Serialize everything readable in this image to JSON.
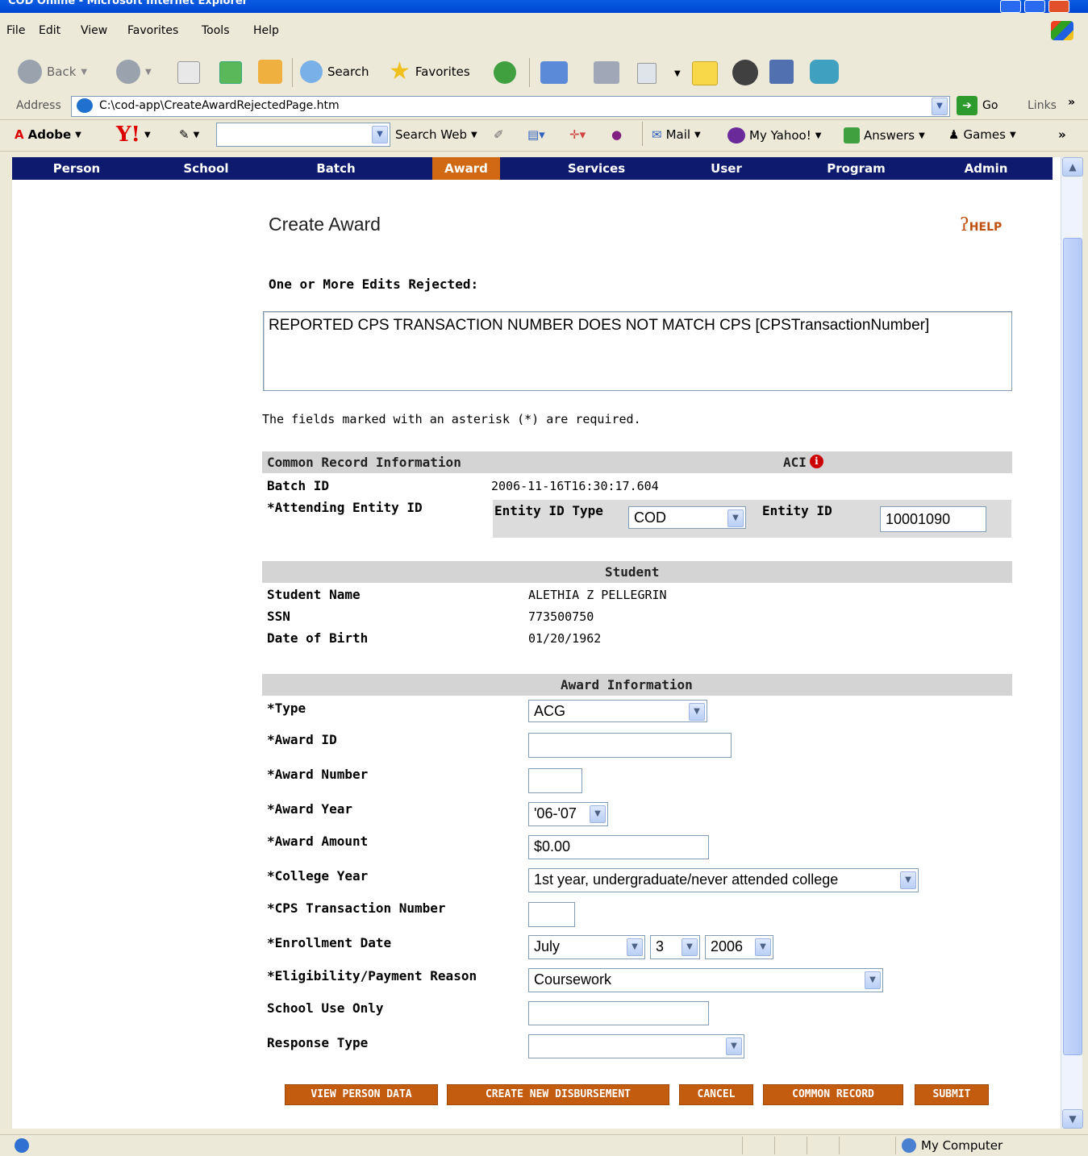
{
  "window": {
    "title": "COD Online - Microsoft Internet Explorer"
  },
  "menu": {
    "items": [
      "File",
      "Edit",
      "View",
      "Favorites",
      "Tools",
      "Help"
    ]
  },
  "toolbar": {
    "back": "Back",
    "search": "Search",
    "favorites": "Favorites"
  },
  "address": {
    "label": "Address",
    "url": "C:\\cod-app\\CreateAwardRejectedPage.htm",
    "go": "Go",
    "links": "Links"
  },
  "yahoo": {
    "adobe": "Adobe",
    "search_web": "Search Web",
    "mail": "Mail",
    "my_yahoo": "My Yahoo!",
    "answers": "Answers",
    "games": "Games"
  },
  "nav": {
    "items": [
      "Person",
      "School",
      "Batch",
      "Award",
      "Services",
      "User",
      "Program",
      "Admin"
    ],
    "active": "Award"
  },
  "page": {
    "title": "Create Award",
    "help": "HELP",
    "error_heading": "One or More Edits Rejected:",
    "error_message": "REPORTED CPS TRANSACTION NUMBER DOES NOT MATCH CPS [CPSTransactionNumber]",
    "required_note": "The fields marked with an asterisk (*) are required."
  },
  "common_record": {
    "section_title": "Common Record Information",
    "aci_label": "ACI",
    "batch_id_label": "Batch ID",
    "batch_id": "2006-11-16T16:30:17.604",
    "attending_entity_label": "*Attending Entity ID",
    "entity_id_type_label": "Entity ID Type",
    "entity_id_type": "COD",
    "entity_id_label": "Entity ID",
    "entity_id": "10001090"
  },
  "student": {
    "section_title": "Student",
    "name_label": "Student Name",
    "name": "ALETHIA Z PELLEGRIN",
    "ssn_label": "SSN",
    "ssn": "773500750",
    "dob_label": "Date of Birth",
    "dob": "01/20/1962"
  },
  "award": {
    "section_title": "Award Information",
    "type_label": "*Type",
    "type": "ACG",
    "award_id_label": "*Award ID",
    "award_id": "",
    "award_number_label": "*Award Number",
    "award_number": "",
    "award_year_label": "*Award Year",
    "award_year": "'06-'07",
    "award_amount_label": "*Award Amount",
    "award_amount": "$0.00",
    "college_year_label": "*College Year",
    "college_year": "1st year, undergraduate/never attended college",
    "cps_label": "*CPS Transaction Number",
    "cps": "",
    "enrollment_label": "*Enrollment Date",
    "enrollment_month": "July",
    "enrollment_day": "3",
    "enrollment_year": "2006",
    "eligibility_label": "*Eligibility/Payment Reason",
    "eligibility": "Coursework",
    "school_use_label": "School Use Only",
    "school_use": "",
    "response_type_label": "Response Type",
    "response_type": ""
  },
  "buttons": {
    "view_person": "VIEW PERSON DATA",
    "create_disbursement": "CREATE NEW DISBURSEMENT",
    "cancel": "CANCEL",
    "common_record": "COMMON RECORD",
    "submit": "SUBMIT"
  },
  "status": {
    "zone": "My Computer"
  }
}
